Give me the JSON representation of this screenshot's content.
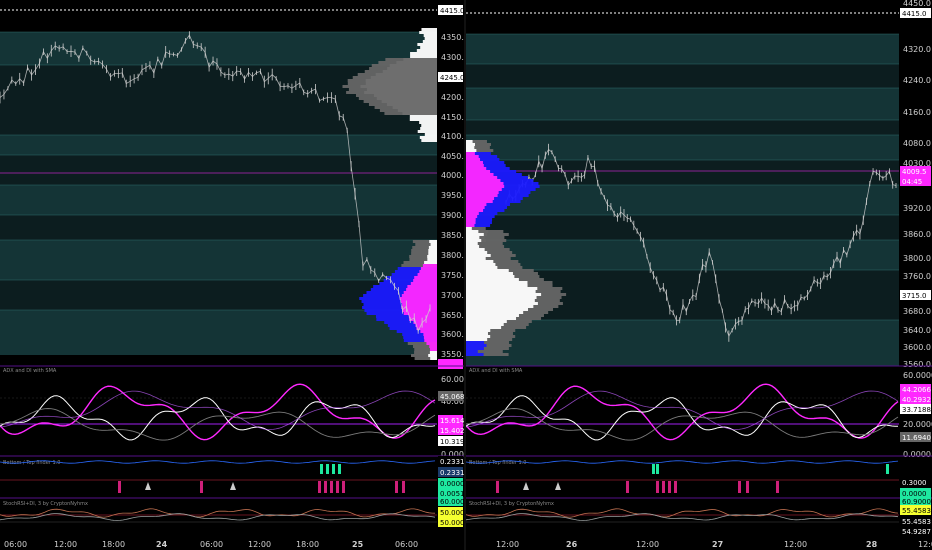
{
  "colors": {
    "band": "#163a3c",
    "band_dark": "#0d2022",
    "price": "#cfcfcf",
    "magenta": "#ff28ff",
    "blue": "#1a1aff",
    "white": "#ffffff",
    "gray": "#7a7a7a",
    "purple_line": "#a020f0",
    "green": "#1ee8a0",
    "pink": "#d0207a",
    "yellow": "#f5ff30"
  },
  "left": {
    "indicator_titles": {
      "osc": "ADX and DI with SMA",
      "bottom": "Bottom / Top finder 1.0",
      "third": "StochRSI+DI, 3 by CryptonNyhmx"
    },
    "price_axis": [
      "4350.0",
      "4300.0",
      "4250.0",
      "4200.0",
      "4150.0",
      "4100.0",
      "4050.0",
      "4000.0",
      "3950.0",
      "3900.0",
      "3850.0",
      "3800.0",
      "3750.0",
      "3700.0",
      "3650.0",
      "3600.0",
      "3550.0"
    ],
    "price_tags": {
      "top": "4415.0",
      "mid": "4245.0"
    },
    "osc_axis": [
      "60.0000",
      "40.0000",
      "20.0000",
      "0.0000"
    ],
    "osc_tags": [
      "45.0687",
      "15.6143",
      "15.4029",
      "10.3191"
    ],
    "bottom_tags": [
      "0.2331",
      "0.2331",
      "0.0000",
      "0.0051"
    ],
    "third_tags": [
      "60.0000",
      "50.0000",
      "50.0000"
    ],
    "time_axis": [
      "06:00",
      "12:00",
      "18:00",
      "24",
      "06:00",
      "12:00",
      "18:00",
      "25",
      "06:00"
    ]
  },
  "right": {
    "indicator_titles": {
      "osc": "ADX and DI with SMA",
      "bottom": "Bottom / Top finder 1.0",
      "third": "StochRSI+DI, 3 by CryptonNyhmx"
    },
    "price_axis": [
      "4450.0",
      "4320.0",
      "4240.0",
      "4160.0",
      "4080.0",
      "4030.0",
      "3920.0",
      "3860.0",
      "3800.0",
      "3760.0",
      "3680.0",
      "3640.0",
      "3600.0",
      "3560.0"
    ],
    "price_tags": {
      "top": "4415.0",
      "magenta": "4009.5",
      "magenta2": "04:45",
      "mid": "3715.0"
    },
    "osc_axis": [
      "60.0000",
      "20.0000",
      "0.0000"
    ],
    "osc_tags": [
      "44.2066",
      "40.2932",
      "33.7188",
      "11.6940"
    ],
    "bottom_tags": [
      "0.3000",
      "0.0000"
    ],
    "third_tags": [
      "60.9000",
      "55.4583",
      "55.4583",
      "54.9287"
    ],
    "time_axis": [
      "12:00",
      "26",
      "12:00",
      "27",
      "12:00",
      "28",
      "12:00"
    ]
  }
}
